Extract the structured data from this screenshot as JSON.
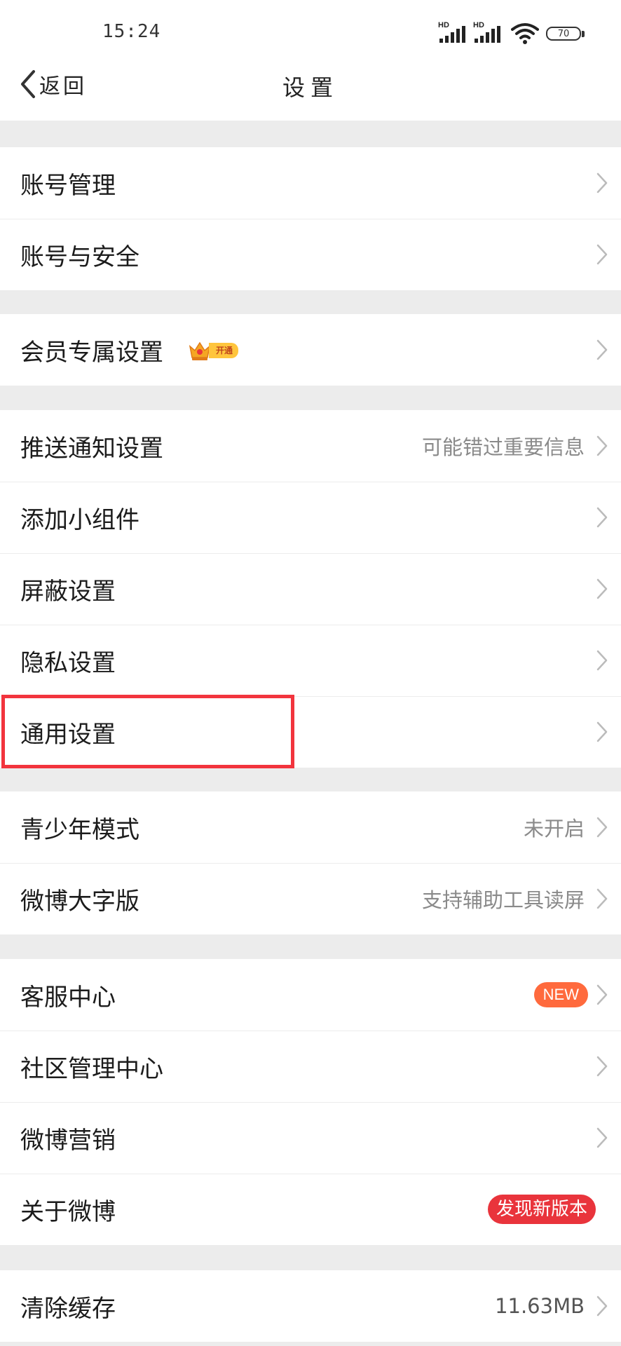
{
  "status": {
    "time": "15:24",
    "sim1": "HD",
    "sim2": "HD",
    "battery": "70"
  },
  "nav": {
    "back_label": "返回",
    "title": "设置"
  },
  "sections": [
    {
      "rows": [
        {
          "label": "账号管理"
        },
        {
          "label": "账号与安全"
        }
      ]
    },
    {
      "rows": [
        {
          "label": "会员专属设置",
          "badge": "开通"
        }
      ]
    },
    {
      "rows": [
        {
          "label": "推送通知设置",
          "value": "可能错过重要信息"
        },
        {
          "label": "添加小组件"
        },
        {
          "label": "屏蔽设置"
        },
        {
          "label": "隐私设置"
        },
        {
          "label": "通用设置"
        }
      ]
    },
    {
      "rows": [
        {
          "label": "青少年模式",
          "value": "未开启"
        },
        {
          "label": "微博大字版",
          "value": "支持辅助工具读屏"
        }
      ]
    },
    {
      "rows": [
        {
          "label": "客服中心",
          "badge": "NEW"
        },
        {
          "label": "社区管理中心"
        },
        {
          "label": "微博营销"
        },
        {
          "label": "关于微博",
          "badge": "发现新版本"
        }
      ]
    },
    {
      "rows": [
        {
          "label": "清除缓存",
          "value": "11.63MB"
        }
      ]
    }
  ],
  "colors": {
    "accent_red": "#e9343c",
    "new_orange": "#ff6a3d",
    "highlight": "#f2343d",
    "vip_gold": "#ffc53d"
  }
}
